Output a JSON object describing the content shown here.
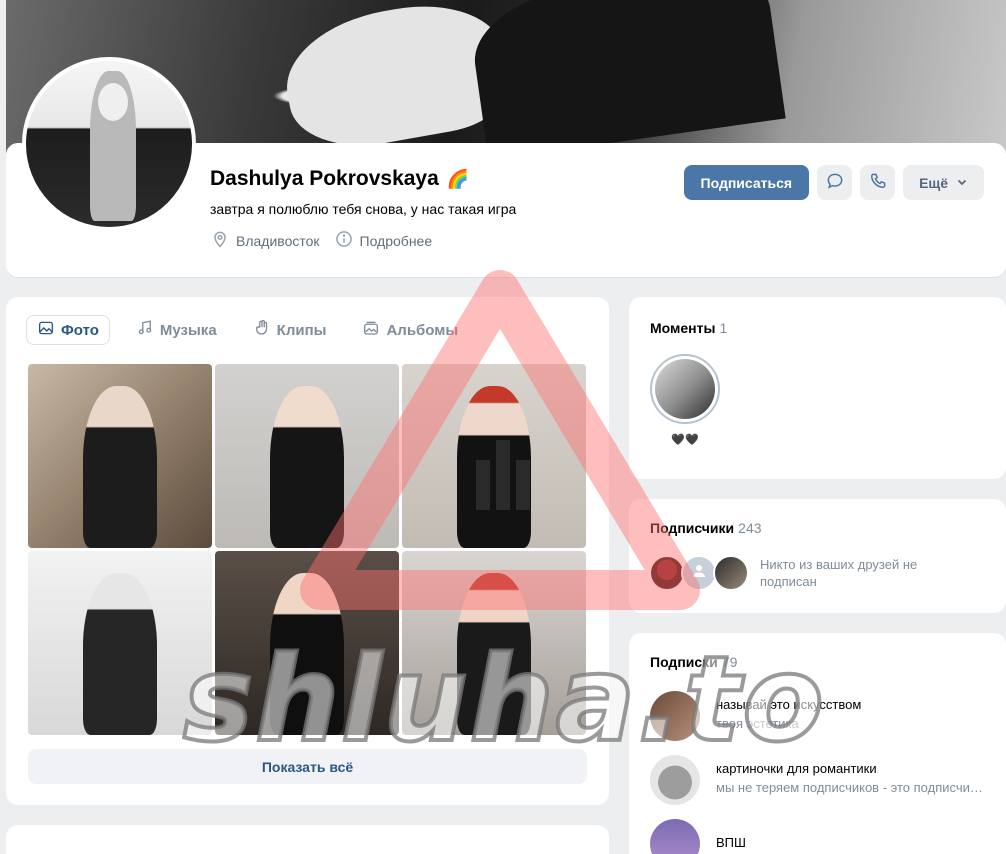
{
  "profile": {
    "name": "Dashulya Pokrovskaya",
    "name_emoji": "🌈",
    "status": "завтра я полюблю тебя снова, у нас такая игра",
    "location": "Владивосток",
    "details_label": "Подробнее"
  },
  "actions": {
    "subscribe_label": "Подписаться",
    "more_label": "Ещё"
  },
  "media": {
    "tabs": [
      {
        "label": "Фото",
        "icon": "image-icon",
        "active": true
      },
      {
        "label": "Музыка",
        "icon": "music-note-icon",
        "active": false
      },
      {
        "label": "Клипы",
        "icon": "clips-icon",
        "active": false
      },
      {
        "label": "Альбомы",
        "icon": "albums-icon",
        "active": false
      }
    ],
    "show_all_label": "Показать всё"
  },
  "moments": {
    "title": "Моменты",
    "count": "1",
    "item_label": "🖤🖤"
  },
  "followers": {
    "title": "Подписчики",
    "count": "243",
    "note": "Никто из ваших друзей не подписан"
  },
  "subscriptions": {
    "title": "Подписки",
    "count": "79",
    "items": [
      {
        "name": "называй это искусством",
        "desc": "твоя эстетика"
      },
      {
        "name": "картиночки для романтики",
        "desc": "мы не теряем подписчиков - это подписчики теряют нас"
      },
      {
        "name": "ВПШ",
        "desc": ""
      }
    ]
  },
  "watermark": {
    "text": "shluha.to"
  },
  "colors": {
    "accent": "#4a76a8",
    "link": "#2a5885",
    "muted": "#818c99",
    "page_bg": "#edeef0"
  }
}
